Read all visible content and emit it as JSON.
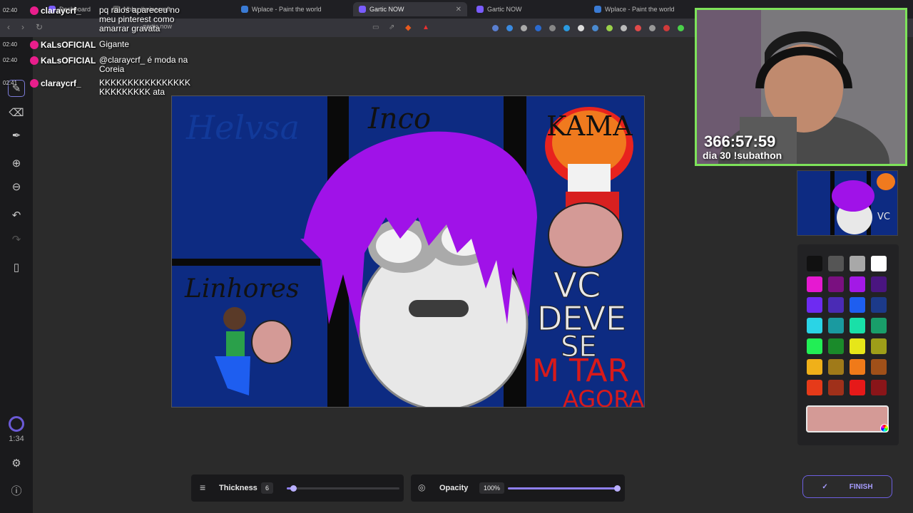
{
  "browser": {
    "tabs": [
      {
        "label": "Dashboard",
        "active": false
      },
      {
        "label": "Nhhu #minecraft",
        "active": false
      },
      {
        "label": "Wplace - Paint the world",
        "active": false
      },
      {
        "label": "Gartic NOW",
        "active": true
      },
      {
        "label": "Gartic NOW",
        "active": false
      },
      {
        "label": "Wplace - Paint the world",
        "active": false
      }
    ],
    "url": "gartic.now"
  },
  "chat": [
    {
      "time": "02:40",
      "user": "claraycrf_",
      "message": "pq raios apareceu no meu pinterest como amarrar gravata"
    },
    {
      "time": "02:40",
      "user": "KaLsOFICIAL",
      "message": "Gigante"
    },
    {
      "time": "02:40",
      "user": "KaLsOFICIAL",
      "message": "@claraycrf_ é moda na Coreia"
    },
    {
      "time": "02:41",
      "user": "claraycrf_",
      "message": "KKKKKKKKKKKKKKKKKKKKKKKKK ata"
    }
  ],
  "stream": {
    "timer": "366:57:59",
    "day_label": "dia 30 !subathon"
  },
  "drawing": {
    "texts": {
      "top_center": "Inco",
      "top_right": "KAMA",
      "left_mid": "Linhores",
      "vc": "VC",
      "deve": "DEVE",
      "se": "SE",
      "matar": "M TAR",
      "agora": "AGORA"
    }
  },
  "game": {
    "timer": "1:34",
    "thickness_label": "Thickness",
    "thickness_value": "6",
    "thickness_fraction": 0.06,
    "opacity_label": "Opacity",
    "opacity_value": "100%",
    "opacity_fraction": 1.0,
    "finish_label": "FINISH",
    "current_color": "#d49a96",
    "palette": [
      "#111111",
      "#555555",
      "#a8a8a8",
      "#ffffff",
      "#e619d1",
      "#7a1080",
      "#a319e6",
      "#4a1580",
      "#6e2bf2",
      "#4a2bb5",
      "#1e5ef0",
      "#1c3a8a",
      "#2ad4e6",
      "#1a9aa0",
      "#19e0a8",
      "#199e6a",
      "#22ee55",
      "#1a8a2a",
      "#e6e619",
      "#9e9e19",
      "#f0b019",
      "#a07a19",
      "#f07a19",
      "#a05019",
      "#e63a19",
      "#a0301a",
      "#e61919",
      "#8a1519"
    ]
  }
}
